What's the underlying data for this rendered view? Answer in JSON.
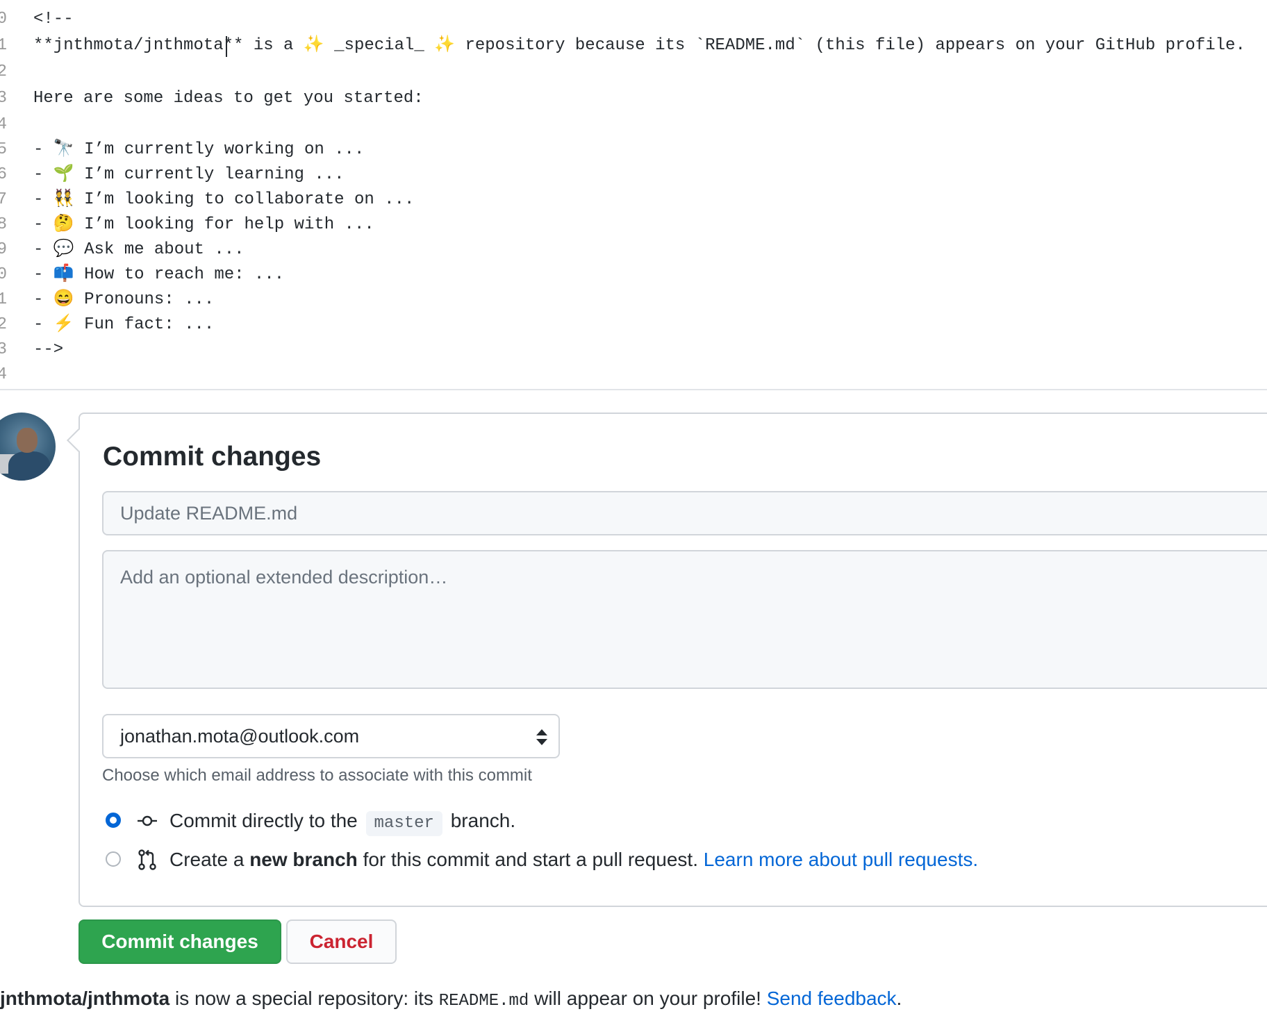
{
  "editor": {
    "lines": [
      {
        "num": "0",
        "text": "<!--"
      },
      {
        "num": "1",
        "text": "**jnthmota/jnthmota** is a ✨ _special_ ✨ repository because its `README.md` (this file) appears on your GitHub profile."
      },
      {
        "num": "2",
        "text": ""
      },
      {
        "num": "3",
        "text": "Here are some ideas to get you started:"
      },
      {
        "num": "4",
        "text": ""
      },
      {
        "num": "5",
        "text": "- 🔭 I’m currently working on ..."
      },
      {
        "num": "6",
        "text": "- 🌱 I’m currently learning ..."
      },
      {
        "num": "7",
        "text": "- 👯 I’m looking to collaborate on ..."
      },
      {
        "num": "8",
        "text": "- 🤔 I’m looking for help with ..."
      },
      {
        "num": "9",
        "text": "- 💬 Ask me about ..."
      },
      {
        "num": "0",
        "text": "- 📫 How to reach me: ..."
      },
      {
        "num": "1",
        "text": "- 😄 Pronouns: ..."
      },
      {
        "num": "2",
        "text": "- ⚡ Fun fact: ..."
      },
      {
        "num": "3",
        "text": "-->"
      },
      {
        "num": "4",
        "text": ""
      }
    ]
  },
  "commit": {
    "title": "Commit changes",
    "summary_placeholder": "Update README.md",
    "description_placeholder": "Add an optional extended description…",
    "email": "jonathan.mota@outlook.com",
    "email_note": "Choose which email address to associate with this commit",
    "option_direct": {
      "prefix": "Commit directly to the",
      "branch": "master",
      "suffix": "branch.",
      "checked": true
    },
    "option_new_branch": {
      "prefix": "Create a",
      "bold": "new branch",
      "suffix": "for this commit and start a pull request.",
      "link": "Learn more about pull requests.",
      "checked": false
    },
    "commit_button": "Commit changes",
    "cancel_button": "Cancel"
  },
  "footer": {
    "repo": "jnthmota/jnthmota",
    "text1": "is now a special repository: its",
    "file": "README.md",
    "text2": "will appear on your profile!",
    "link": "Send feedback",
    "end": "."
  },
  "colors": {
    "accent": "#0366d6",
    "commit_green": "#2ea44f",
    "cancel_red": "#cb2431"
  }
}
